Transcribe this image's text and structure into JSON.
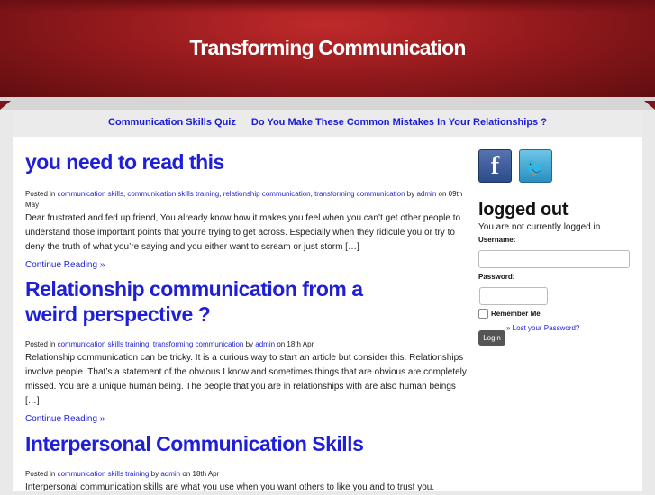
{
  "site": {
    "title": "Transforming Communication"
  },
  "nav": {
    "items": [
      {
        "label": "Communication Skills Quiz"
      },
      {
        "label": "Do You Make These Common Mistakes In Your Relationships ?"
      }
    ]
  },
  "posts": [
    {
      "title": "you need to read this",
      "posted_in": "Posted in",
      "categories": [
        "communication skills",
        "communication skills training",
        "relationship communication",
        "transforming communication"
      ],
      "by": "by",
      "author": "admin",
      "date": "on 09th May",
      "excerpt": "Dear frustrated and fed up friend, You already know how it makes you feel when you can’t get other people to understand those important points that you’re trying to get across. Especially when they ridicule you or try to deny the truth of what you’re saying and you either want to scream or just storm […]",
      "more": "Continue Reading »"
    },
    {
      "title": "Relationship communication from a weird perspective ?",
      "posted_in": "Posted in",
      "categories": [
        "communication skills training",
        "transforming communication"
      ],
      "by": "by",
      "author": "admin",
      "date": "on 18th Apr",
      "excerpt": " Relationship communication can be tricky. It is a curious way to start an article but consider this. Relationships involve people. That’s a statement of the obvious I know and sometimes things that are obvious are completely missed. You are a unique human being. The people that you are in relationships with are also human beings […]",
      "more": "Continue Reading »"
    },
    {
      "title": "Interpersonal Communication Skills",
      "posted_in": "Posted in",
      "categories": [
        "communication skills training"
      ],
      "by": "by",
      "author": "admin",
      "date": "on 18th Apr",
      "excerpt": "Interpersonal communication skills are what you use when you want others to like you and to trust you.",
      "more": ""
    }
  ],
  "sidebar": {
    "facebook_icon": "f",
    "twitter_icon": "bird",
    "heading": "logged out",
    "status": "You are not currently logged in.",
    "username_label": "Username:",
    "password_label": "Password:",
    "remember_label": "Remember Me",
    "lost_password": "» Lost your Password?",
    "login_button": "Login"
  }
}
